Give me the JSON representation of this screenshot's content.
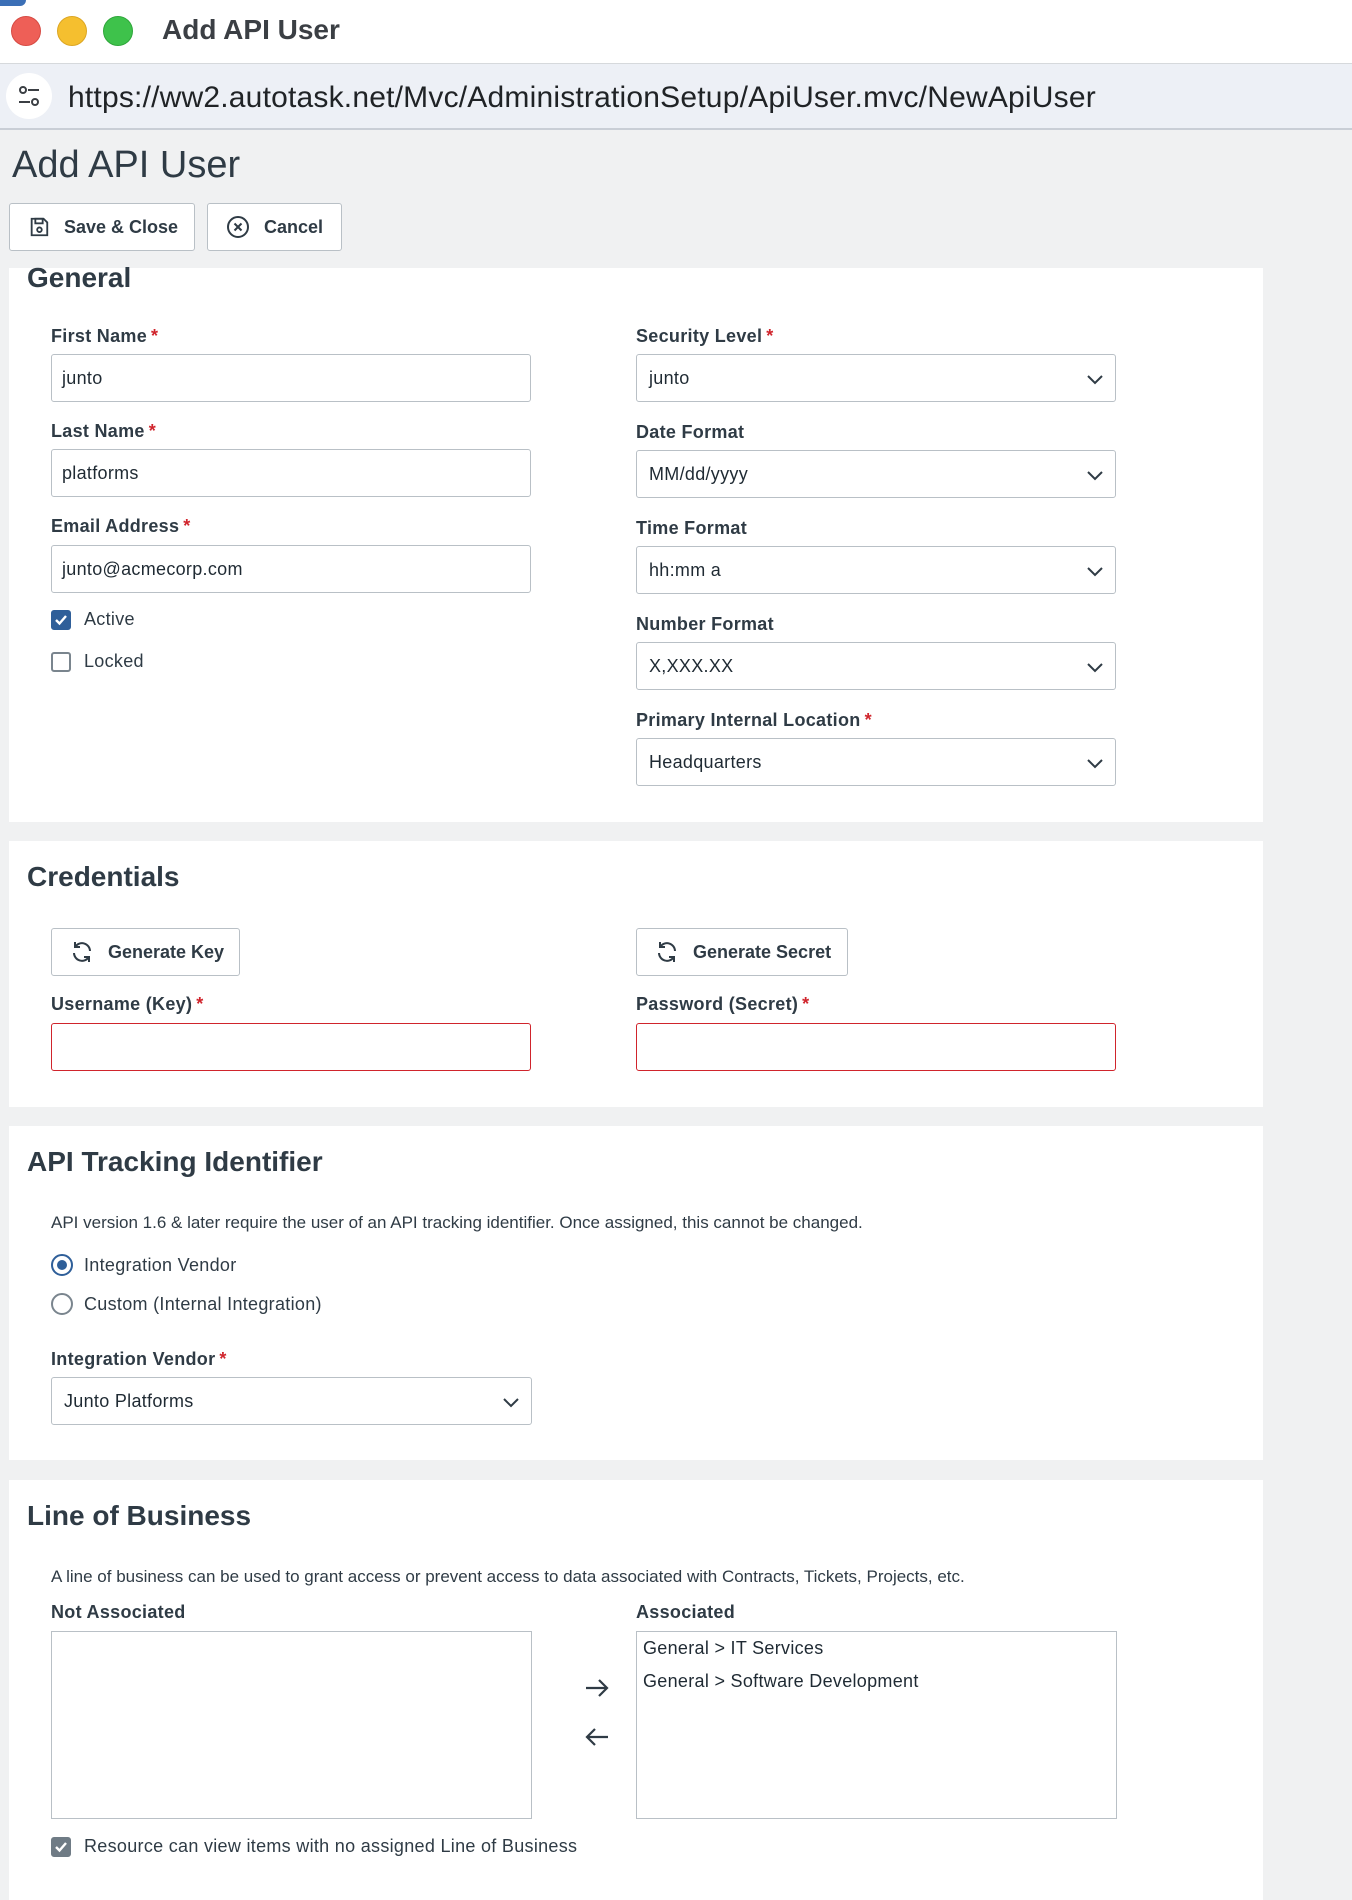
{
  "window": {
    "title": "Add API User"
  },
  "browser": {
    "url": "https://ww2.autotask.net/Mvc/AdministrationSetup/ApiUser.mvc/NewApiUser"
  },
  "page": {
    "title": "Add API User"
  },
  "toolbar": {
    "save_label": "Save & Close",
    "cancel_label": "Cancel"
  },
  "general": {
    "title": "General",
    "first_name": {
      "label": "First Name",
      "value": "junto"
    },
    "last_name": {
      "label": "Last Name",
      "value": "platforms"
    },
    "email": {
      "label": "Email Address",
      "value": "junto@acmecorp.com"
    },
    "active": {
      "label": "Active",
      "checked": true
    },
    "locked": {
      "label": "Locked",
      "checked": false
    },
    "security_level": {
      "label": "Security Level",
      "value": "junto"
    },
    "date_format": {
      "label": "Date Format",
      "value": "MM/dd/yyyy"
    },
    "time_format": {
      "label": "Time Format",
      "value": "hh:mm a"
    },
    "number_format": {
      "label": "Number Format",
      "value": "X,XXX.XX"
    },
    "primary_location": {
      "label": "Primary Internal Location",
      "value": "Headquarters"
    }
  },
  "credentials": {
    "title": "Credentials",
    "generate_key_label": "Generate Key",
    "generate_secret_label": "Generate Secret",
    "username": {
      "label": "Username (Key)",
      "value": ""
    },
    "password": {
      "label": "Password (Secret)",
      "value": ""
    }
  },
  "tracking": {
    "title": "API Tracking Identifier",
    "description": "API version 1.6 & later require the user of an API tracking identifier. Once assigned, this cannot be changed.",
    "options": [
      {
        "label": "Integration Vendor",
        "selected": true
      },
      {
        "label": "Custom (Internal Integration)",
        "selected": false
      }
    ],
    "vendor": {
      "label": "Integration Vendor",
      "value": "Junto Platforms"
    }
  },
  "line_of_business": {
    "title": "Line of Business",
    "description": "A line of business can be used to grant access or prevent access to data associated with Contracts, Tickets, Projects, etc.",
    "not_associated_label": "Not Associated",
    "associated_label": "Associated",
    "not_associated": [],
    "associated": [
      "General > IT Services",
      "General > Software Development"
    ],
    "no_lob_checkbox": {
      "label": "Resource can view items with no assigned Line of Business",
      "checked": true
    }
  },
  "colors": {
    "required": "#d0242c",
    "accent": "#2f5f99",
    "text": "#2f3b45"
  }
}
